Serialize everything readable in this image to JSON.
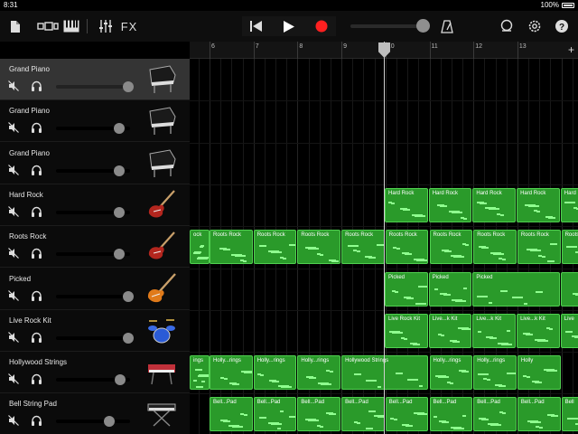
{
  "status": {
    "time": "8:31",
    "battery": "100%"
  },
  "toolbar": {
    "fx_label": "FX"
  },
  "ruler": {
    "bars": [
      "6",
      "7",
      "8",
      "9",
      "10",
      "11",
      "12",
      "13"
    ]
  },
  "tracks": [
    {
      "name": "Grand Piano",
      "volume": 0.98,
      "selected": true,
      "instrument": "grand-piano-icon"
    },
    {
      "name": "Grand Piano",
      "volume": 0.85,
      "selected": false,
      "instrument": "grand-piano-icon"
    },
    {
      "name": "Grand Piano",
      "volume": 0.85,
      "selected": false,
      "instrument": "grand-piano-icon"
    },
    {
      "name": "Hard Rock",
      "volume": 0.85,
      "selected": false,
      "instrument": "electric-guitar-icon"
    },
    {
      "name": "Roots Rock",
      "volume": 0.85,
      "selected": false,
      "instrument": "electric-guitar-icon"
    },
    {
      "name": "Picked",
      "volume": 0.98,
      "selected": false,
      "instrument": "bass-guitar-icon"
    },
    {
      "name": "Live Rock Kit",
      "volume": 0.98,
      "selected": false,
      "instrument": "drum-kit-icon"
    },
    {
      "name": "Hollywood Strings",
      "volume": 0.87,
      "selected": false,
      "instrument": "keyboard-synth-icon"
    },
    {
      "name": "Bell String Pad",
      "volume": 0.72,
      "selected": false,
      "instrument": "keyboard-stand-icon"
    }
  ],
  "regions": [
    {
      "row": 3,
      "label": "Hard Rock"
    },
    {
      "row": 3,
      "label": "Hard Rock"
    },
    {
      "row": 3,
      "label": "Hard Rock"
    },
    {
      "row": 3,
      "label": "Hard Rock"
    },
    {
      "row": 3,
      "label": "Hard"
    },
    {
      "row": 4,
      "label": "ock"
    },
    {
      "row": 4,
      "label": "Roots Rock"
    },
    {
      "row": 4,
      "label": "Roots Rock"
    },
    {
      "row": 4,
      "label": "Roots Rock"
    },
    {
      "row": 4,
      "label": "Roots Rock"
    },
    {
      "row": 4,
      "label": "Roots Rock"
    },
    {
      "row": 4,
      "label": "Roots Rock"
    },
    {
      "row": 4,
      "label": "Roots Rock"
    },
    {
      "row": 4,
      "label": "Roots Rock"
    },
    {
      "row": 4,
      "label": "Roots"
    },
    {
      "row": 5,
      "label": "Picked"
    },
    {
      "row": 5,
      "label": "Picked"
    },
    {
      "row": 5,
      "label": "Picked"
    },
    {
      "row": 5,
      "label": ""
    },
    {
      "row": 6,
      "label": "Live Rock Kit"
    },
    {
      "row": 6,
      "label": "Live...k Kit"
    },
    {
      "row": 6,
      "label": "Live...k Kit"
    },
    {
      "row": 6,
      "label": "Live...k Kit"
    },
    {
      "row": 6,
      "label": "Live"
    },
    {
      "row": 7,
      "label": "ings"
    },
    {
      "row": 7,
      "label": "Holly...rings"
    },
    {
      "row": 7,
      "label": "Holly...rings"
    },
    {
      "row": 7,
      "label": "Holly...rings"
    },
    {
      "row": 7,
      "label": "Hollywood Strings"
    },
    {
      "row": 7,
      "label": "Holly...rings"
    },
    {
      "row": 7,
      "label": "Holly...rings"
    },
    {
      "row": 7,
      "label": "Holly"
    },
    {
      "row": 8,
      "label": "Bell...Pad"
    },
    {
      "row": 8,
      "label": "Bell...Pad"
    },
    {
      "row": 8,
      "label": "Bell...Pad"
    },
    {
      "row": 8,
      "label": "Bell...Pad"
    },
    {
      "row": 8,
      "label": "Bell...Pad"
    },
    {
      "row": 8,
      "label": "Bell...Pad"
    },
    {
      "row": 8,
      "label": "Bell...Pad"
    },
    {
      "row": 8,
      "label": "Bell...Pad"
    },
    {
      "row": 8,
      "label": "Bell"
    }
  ],
  "colors": {
    "region_fill": "#2a9a2a",
    "region_border": "#50d050",
    "record": "#ff2020",
    "selected_track": "#343434"
  }
}
